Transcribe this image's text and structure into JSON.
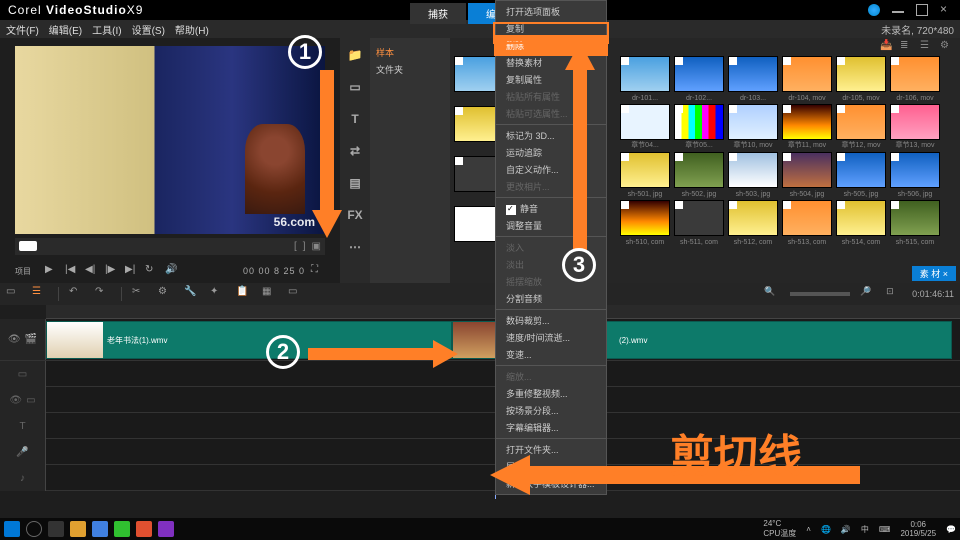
{
  "app": {
    "brand1": "Corel ",
    "brand2": "VideoStudio",
    "brand3": "X9"
  },
  "menu": {
    "file": "文件(F)",
    "edit": "编辑(E)",
    "tool": "工具(I)",
    "set": "设置(S)",
    "help": "帮助(H)",
    "right": "未录名, 720*480"
  },
  "toptabs": {
    "a": "捕获",
    "b": "编辑"
  },
  "preview": {
    "watermark": "56.com",
    "mode": "项目",
    "timecode": "00 00 8 25 0"
  },
  "libside": {
    "i1": "📁",
    "i2": "▭",
    "i3": "T",
    "i4": "⇄",
    "i5": "▤",
    "i6": "FX",
    "i7": "⋯"
  },
  "libtree": {
    "r1": "样本",
    "r2": "文件夹"
  },
  "ctx": {
    "m0": "打开选项面板",
    "m1": "复制",
    "m2": "删除",
    "m3": "替换素材",
    "m4": "复制属性",
    "m5": "粘贴所有属性",
    "m6": "粘贴可选属性...",
    "sep": "",
    "m7": "标记为 3D...",
    "m8": "运动追踪",
    "m9": "自定义动作...",
    "m10": "更改相片...",
    "m11": "静音",
    "m12": "调整音量",
    "m13": "淡入",
    "m14": "淡出",
    "m15": "摇摆缩放",
    "m16": "分割音频",
    "m17": "数码裁剪...",
    "m18": "速度/时间流逝...",
    "m19": "变速...",
    "m20": "缩放...",
    "m21": "多重修整视频...",
    "m22": "按场景分段...",
    "m23": "字幕编辑器...",
    "m24": "打开文件夹...",
    "m25": "属性...",
    "m26": "新增快手模板设计器..."
  },
  "thumbs": {
    "r1c1": "dr-101...",
    "r1c2": "dr-102...",
    "r1c3": "dr-103...",
    "r1c4": "dr-104, mov",
    "r1c5": "dr-105, mov",
    "r1c6": "dr-106, mov",
    "r2c1": "章节04...",
    "r2c2": "章节05...",
    "r2c3": "章节10, mov",
    "r2c4": "章节11, mov",
    "r2c5": "章节12, mov",
    "r2c6": "章节13, mov",
    "r3c1": "sh-501, jpg",
    "r3c2": "sh-502, jpg",
    "r3c3": "sh-503, jpg",
    "r3c4": "sh-504, jpg",
    "r3c5": "sh-505, jpg",
    "r3c6": "sh-506, jpg",
    "r4c1": "sh-510, com",
    "r4c2": "sh-511, com",
    "r4c3": "sh-512, com",
    "r4c4": "sh-513, com",
    "r4c5": "sh-514, com",
    "r4c6": "sh-515, com"
  },
  "libbtn": "素 材  ×",
  "timeline": {
    "time_display": "0:01:46:11",
    "clip1": "老年书法(1).wmv",
    "clip2": "(2).wmv"
  },
  "annot": {
    "cutline": "剪切线"
  },
  "taskbar": {
    "temp": "24°C",
    "cpu": "CPU温度",
    "zh": "中",
    "time": "0:06",
    "date": "2019/5/25"
  }
}
